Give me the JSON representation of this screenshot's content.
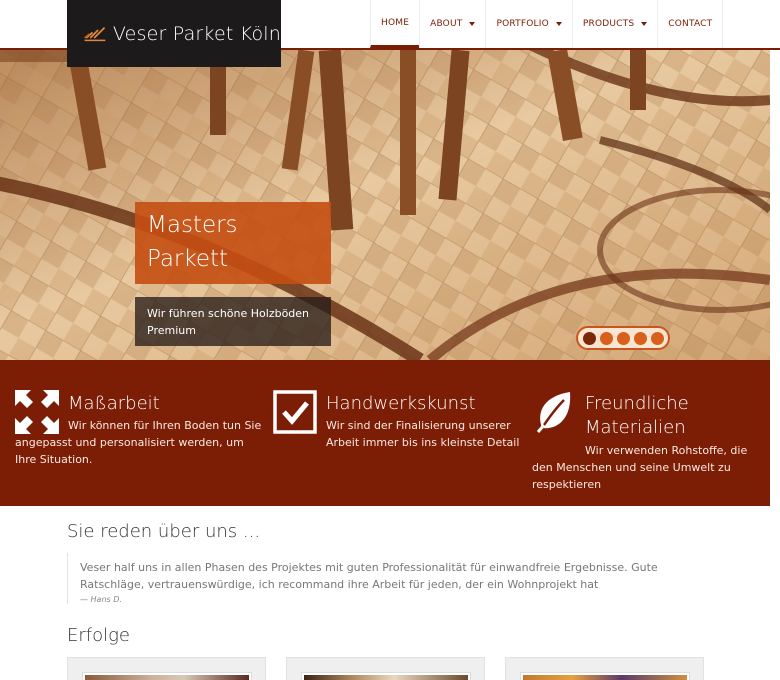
{
  "brand": {
    "name": "Veser Parket Köln"
  },
  "nav": [
    {
      "label": "HOME",
      "active": true,
      "dropdown": false
    },
    {
      "label": "ABOUT",
      "active": false,
      "dropdown": true
    },
    {
      "label": "PORTFOLIO",
      "active": false,
      "dropdown": true
    },
    {
      "label": "PRODUCTS",
      "active": false,
      "dropdown": true
    },
    {
      "label": "CONTACT",
      "active": false,
      "dropdown": false
    }
  ],
  "hero": {
    "title_line1": "Masters",
    "title_line2": "Parkett",
    "subtitle": "Wir führen schöne Holzböden Premium",
    "slides": 5,
    "active_slide": 1
  },
  "features": [
    {
      "icon": "expand-arrows-icon",
      "title": "Maßarbeit",
      "text": "Wir können für Ihren Boden tun Sie angepasst und personalisiert werden, um Ihre Situation."
    },
    {
      "icon": "checkbox-icon",
      "title": "Handwerkskunst",
      "text": "Wir sind der Finalisierung unserer Arbeit immer bis ins kleinste Detail"
    },
    {
      "icon": "leaf-icon",
      "title": "Freundliche Materialien",
      "text": "Wir verwenden Rohstoffe, die den Menschen und seine Umwelt zu respektieren"
    }
  ],
  "testimonials": {
    "heading": "Sie reden über uns ...",
    "quote": "Veser half uns in allen Phasen des Projektes mit guten Professionalität für einwandfreie Ergebnisse. Gute Ratschläge, vertrauenswürdige, ich recommand ihre Arbeit für jeden, der ein Wohnprojekt hat",
    "author": "— Hans D."
  },
  "success": {
    "heading": "Erfolge"
  },
  "colors": {
    "brand_dark": "#7c1d06",
    "accent_orange": "#c44e12",
    "logo_bg": "#1c1a1a"
  }
}
